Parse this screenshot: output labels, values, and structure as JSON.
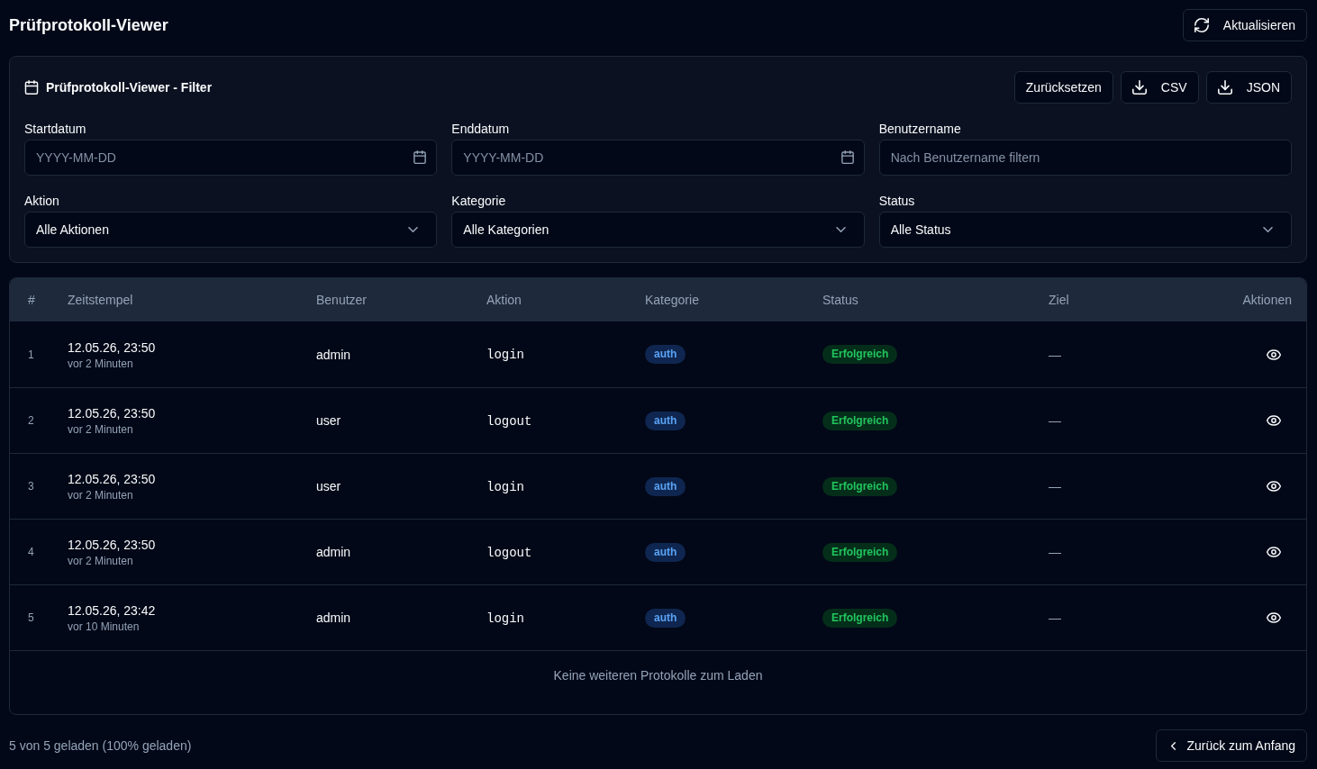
{
  "header": {
    "title": "Prüfprotokoll-Viewer",
    "refresh_button": "Aktualisieren"
  },
  "filter": {
    "title": "Prüfprotokoll-Viewer - Filter",
    "buttons": [
      {
        "label": "Zurücksetzen",
        "kind": "plain"
      },
      {
        "label": "CSV",
        "kind": "download"
      },
      {
        "label": "JSON",
        "kind": "download"
      }
    ],
    "fields": [
      {
        "label": "Startdatum",
        "kind": "date",
        "placeholder": "YYYY-MM-DD"
      },
      {
        "label": "Enddatum",
        "kind": "date",
        "placeholder": "YYYY-MM-DD"
      },
      {
        "label": "Benutzername",
        "kind": "text",
        "placeholder": "Nach Benutzername filtern"
      },
      {
        "label": "Aktion",
        "kind": "select",
        "value": "Alle Aktionen"
      },
      {
        "label": "Kategorie",
        "kind": "select",
        "value": "Alle Kategorien"
      },
      {
        "label": "Status",
        "kind": "select",
        "value": "Alle Status"
      }
    ]
  },
  "table": {
    "columns": [
      "#",
      "Zeitstempel",
      "Benutzer",
      "Aktion",
      "Kategorie",
      "Status",
      "Ziel",
      "Aktionen"
    ],
    "rows": [
      {
        "index": "1",
        "timestamp": "12.05.26, 23:50",
        "relative_time": "vor 2 Minuten",
        "user": "admin",
        "action": "login",
        "category": "auth",
        "status": "Erfolgreich",
        "target": "—"
      },
      {
        "index": "2",
        "timestamp": "12.05.26, 23:50",
        "relative_time": "vor 2 Minuten",
        "user": "user",
        "action": "logout",
        "category": "auth",
        "status": "Erfolgreich",
        "target": "—"
      },
      {
        "index": "3",
        "timestamp": "12.05.26, 23:50",
        "relative_time": "vor 2 Minuten",
        "user": "user",
        "action": "login",
        "category": "auth",
        "status": "Erfolgreich",
        "target": "—"
      },
      {
        "index": "4",
        "timestamp": "12.05.26, 23:50",
        "relative_time": "vor 2 Minuten",
        "user": "admin",
        "action": "logout",
        "category": "auth",
        "status": "Erfolgreich",
        "target": "—"
      },
      {
        "index": "5",
        "timestamp": "12.05.26, 23:42",
        "relative_time": "vor 10 Minuten",
        "user": "admin",
        "action": "login",
        "category": "auth",
        "status": "Erfolgreich",
        "target": "—"
      }
    ],
    "footer_message": "Keine weiteren Protokolle zum Laden"
  },
  "footer": {
    "summary": "5 von 5 geladen (100% geladen)",
    "back_button": "Zurück zum Anfang"
  }
}
